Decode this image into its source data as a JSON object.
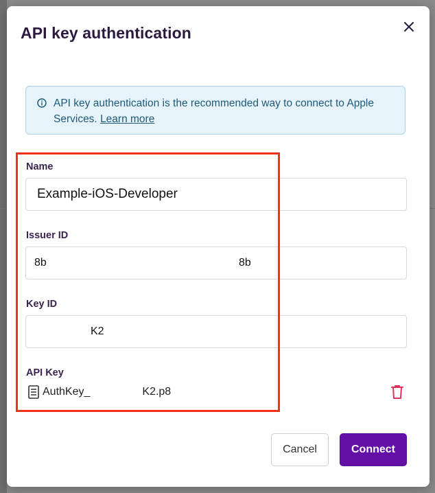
{
  "dialog": {
    "title": "API key authentication",
    "close_icon": "close-icon"
  },
  "info": {
    "icon": "info-icon",
    "text": "API key authentication is the recommended way to connect to Apple Services.",
    "link": "Learn more"
  },
  "form": {
    "name": {
      "label": "Name",
      "value": "Example-iOS-Developer"
    },
    "issuer_id": {
      "label": "Issuer ID",
      "value_start": "8b",
      "value_end": "8b"
    },
    "key_id": {
      "label": "Key ID",
      "value_end": "K2"
    },
    "api_key": {
      "label": "API Key",
      "file_icon": "file-icon",
      "file_name_start": "AuthKey_",
      "file_name_end": "K2.p8",
      "delete_icon": "trash-icon"
    }
  },
  "actions": {
    "cancel": "Cancel",
    "connect": "Connect"
  },
  "colors": {
    "title": "#2b1a3f",
    "label": "#3b2350",
    "info_bg": "#e6f3fa",
    "info_text": "#1d5a7a",
    "highlight": "#f2301b",
    "primary": "#6410a6",
    "danger": "#e0325a"
  }
}
